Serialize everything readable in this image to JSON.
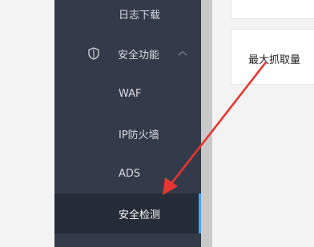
{
  "sidebar": {
    "items": [
      {
        "label": "日志下载"
      },
      {
        "label": "安全功能"
      },
      {
        "label": "WAF"
      },
      {
        "label": "IP防火墙"
      },
      {
        "label": "ADS"
      },
      {
        "label": "安全检测"
      }
    ]
  },
  "content": {
    "card_title": "最大抓取量"
  },
  "colors": {
    "sidebar_bg": "#333a49",
    "active_bg": "#262c37",
    "active_accent": "#4aa3e8",
    "arrow": "#e8352f"
  },
  "icons": {
    "security_group": "shield-icon",
    "expand_state": "chevron-up-icon"
  }
}
